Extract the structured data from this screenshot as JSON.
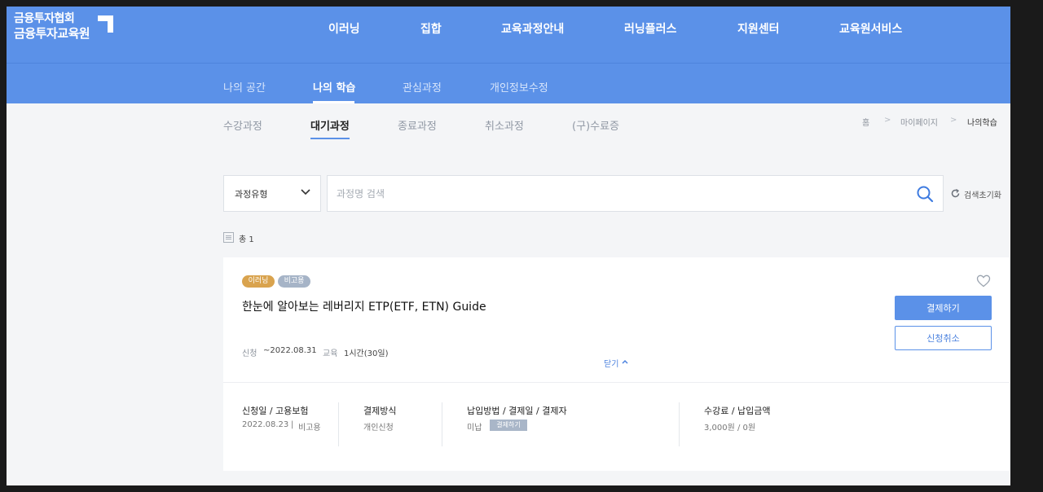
{
  "logo": {
    "line1": "금융투자협회",
    "line2": "금융투자교육원"
  },
  "gnb": [
    "이러닝",
    "집합",
    "교육과정안내",
    "러닝플러스",
    "지원센터",
    "교육원서비스"
  ],
  "lnb": [
    "나의 공간",
    "나의 학습",
    "관심과정",
    "개인정보수정"
  ],
  "tabs": [
    "수강과정",
    "대기과정",
    "종료과정",
    "취소과정",
    "(구)수료증"
  ],
  "breadcrumb": [
    "홈",
    "마이페이지",
    "나의학습"
  ],
  "search": {
    "select_value": "과정유형",
    "placeholder": "과정명 검색",
    "reset_label": "검색초기화"
  },
  "total_label": "총 1",
  "course": {
    "badges": [
      "이러닝",
      "비고용"
    ],
    "title": "한눈에 알아보는 레버리지 ETP(ETF, ETN) Guide",
    "apply_label": "신청",
    "apply_value": "~2022.08.31",
    "edu_label": "교육",
    "edu_value": "1시간(30일)",
    "pay_button": "결제하기",
    "cancel_button": "신청취소",
    "collapse_label": "닫기",
    "details": {
      "col1_header": "신청일 / 고용보험",
      "col1_date": "2022.08.23",
      "col1_ins": "비고용",
      "col2_header": "결제방식",
      "col2_value": "개인신청",
      "col3_header": "납입방법 / 결제일 / 결제자",
      "col3_value": "미납",
      "col3_tag": "결제하기",
      "col4_header": "수강료 / 납입금액",
      "col4_value": "3,000원 / 0원"
    }
  },
  "colors": {
    "primary": "#5b91e8",
    "badge_elearning": "#d9a34e",
    "badge_nonemp": "#a6b4c7"
  }
}
